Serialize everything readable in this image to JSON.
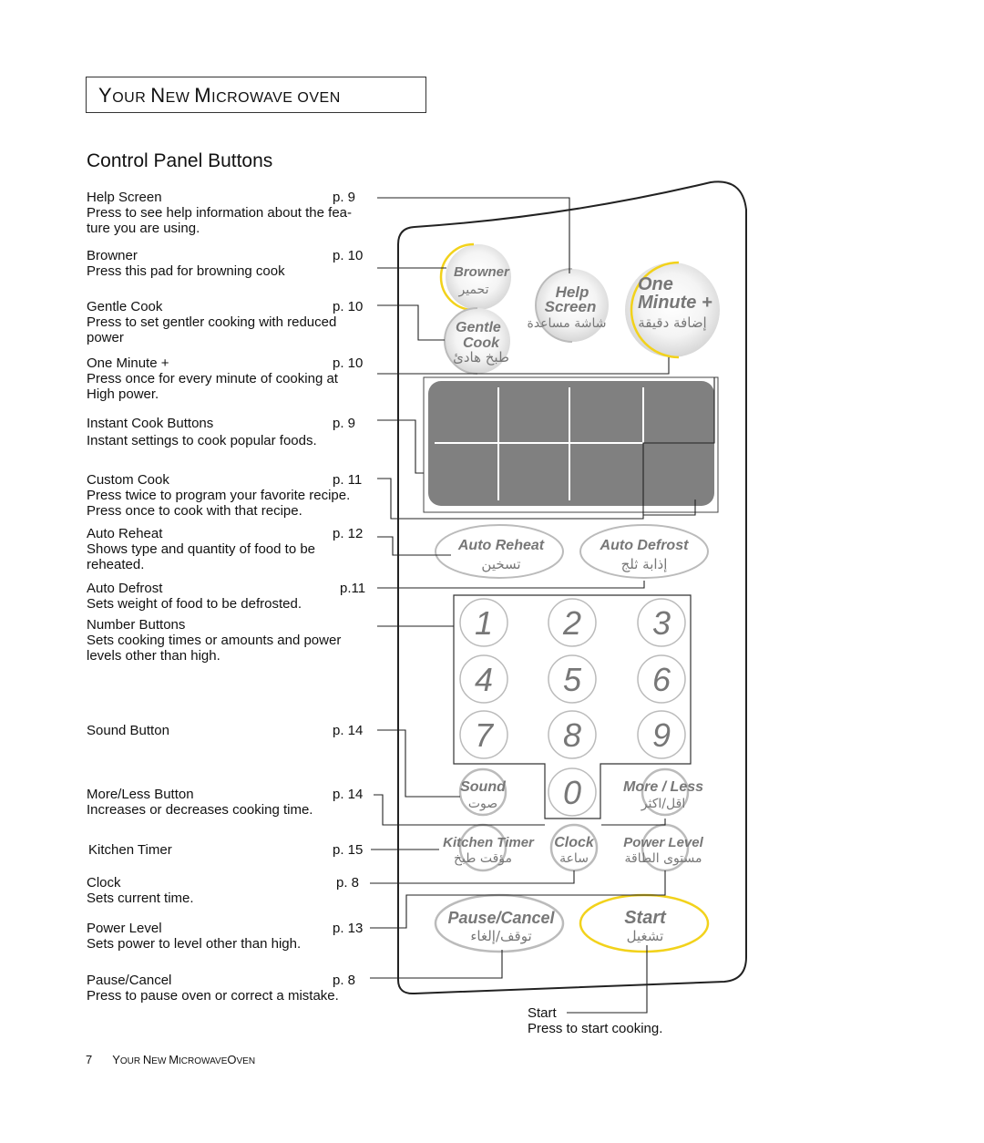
{
  "header": {
    "title_parts": [
      {
        "big": "Y",
        "small": "OUR "
      },
      {
        "big": "N",
        "small": "EW "
      },
      {
        "big": "M",
        "small": "ICROWAVE OVEN"
      }
    ]
  },
  "section_title": "Control Panel Buttons",
  "descriptions": [
    {
      "label": "Help Screen",
      "page": "p. 9",
      "text": "Press to see help information about the fea-\nture you are using."
    },
    {
      "label": "Browner",
      "page": "p. 10",
      "text": "Press this pad for browning cook"
    },
    {
      "label": "Gentle Cook",
      "page": "p. 10",
      "text": "Press to set gentler cooking with reduced\npower"
    },
    {
      "label": "One Minute +",
      "page": "p. 10",
      "text": "Press once for every minute of cooking at\nHigh power."
    },
    {
      "label": "Instant Cook Buttons",
      "page": "p. 9",
      "text": "Instant settings to cook popular foods."
    },
    {
      "label": "Custom Cook",
      "page": "p. 11",
      "text": "Press twice to program your favorite recipe.\nPress once to cook with that recipe."
    },
    {
      "label": "Auto Reheat",
      "page": "p. 12",
      "text": "Shows type and quantity of food to be\nreheated."
    },
    {
      "label": "Auto Defrost",
      "page": "p.11",
      "text": "Sets weight of food to be defrosted."
    },
    {
      "label": "Number Buttons",
      "page": "",
      "text": "Sets cooking times or amounts and power\nlevels other than high."
    },
    {
      "label": "Sound Button",
      "page": "p. 14",
      "text": ""
    },
    {
      "label": "More/Less Button",
      "page": "p. 14",
      "text": "Increases or decreases cooking time."
    },
    {
      "label": "Kitchen Timer",
      "page": "p. 15",
      "text": ""
    },
    {
      "label": "Clock",
      "page": "p. 8",
      "text": "Sets current time."
    },
    {
      "label": "Power Level",
      "page": "p. 13",
      "text": "Sets power to level other than high."
    },
    {
      "label": "Pause/Cancel",
      "page": "p.  8",
      "text": "Press to pause oven or correct a mistake."
    }
  ],
  "start_note": {
    "label": "Start",
    "text": "Press to start cooking."
  },
  "panel_buttons": {
    "browner": {
      "en": "Browner",
      "ar": "تحمير"
    },
    "help_screen": {
      "en1": "Help",
      "en2": "Screen",
      "ar": "شاشة مساعدة"
    },
    "one_minute": {
      "en1": "One",
      "en2": "Minute +",
      "ar": "إضافة دقيقة"
    },
    "gentle_cook": {
      "en1": "Gentle",
      "en2": "Cook",
      "ar": "طبخ هادئ"
    },
    "auto_reheat": {
      "en": "Auto Reheat",
      "ar": "تسخين"
    },
    "auto_defrost": {
      "en": "Auto Defrost",
      "ar": "إذابة ثلج"
    },
    "numbers": [
      "1",
      "2",
      "3",
      "4",
      "5",
      "6",
      "7",
      "8",
      "9",
      "0"
    ],
    "sound": {
      "en": "Sound",
      "ar": "صوت"
    },
    "more_less": {
      "en": "More / Less",
      "ar": "اقل/اكثر"
    },
    "kitchen_timer": {
      "en": "Kitchen Timer",
      "ar": "مؤقت طبخ"
    },
    "clock": {
      "en": "Clock",
      "ar": "ساعة"
    },
    "power_level": {
      "en": "Power Level",
      "ar": "مستوى الطاقة"
    },
    "pause_cancel": {
      "en": "Pause/Cancel",
      "ar": "توقف/إلغاء"
    },
    "start": {
      "en": "Start",
      "ar": "تشغيل"
    }
  },
  "colors": {
    "accent_yellow": "#f2d21b",
    "button_gray": "#bbbbbb",
    "display_gray": "#808080",
    "text_gray": "#777777"
  },
  "footer": {
    "page_number": "7",
    "title_parts": [
      {
        "big": "Y",
        "small": "OUR "
      },
      {
        "big": "N",
        "small": "EW "
      },
      {
        "big": "M",
        "small": "ICROWAVE"
      },
      {
        "big": "O",
        "small": "VEN"
      }
    ]
  }
}
